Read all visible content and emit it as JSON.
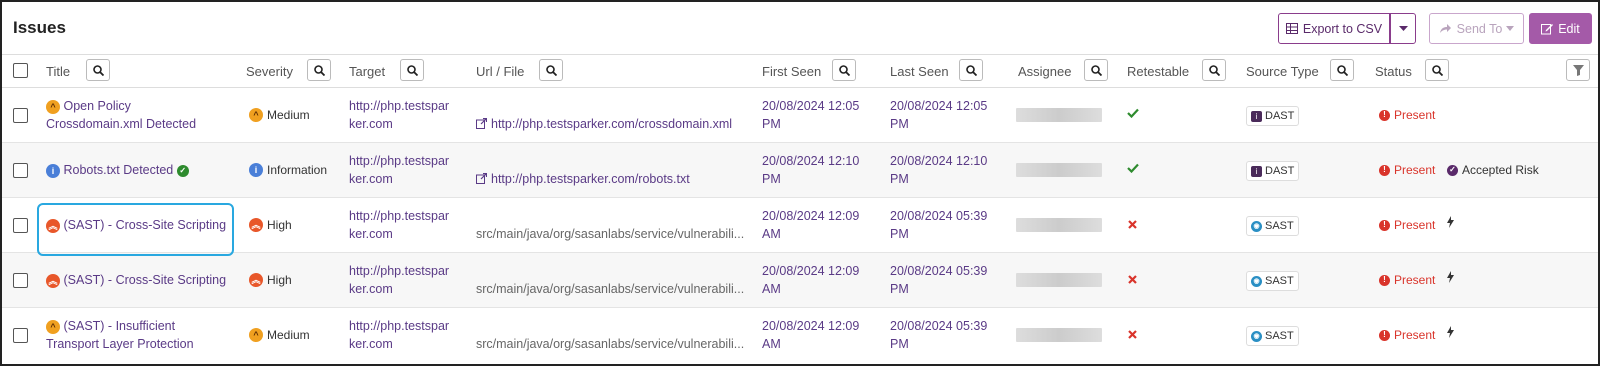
{
  "header": {
    "title": "Issues",
    "export_label": "Export to CSV",
    "send_label": "Send To",
    "edit_label": "Edit"
  },
  "columns": {
    "title": "Title",
    "severity": "Severity",
    "target": "Target",
    "url": "Url / File",
    "first_seen": "First Seen",
    "last_seen": "Last Seen",
    "assignee": "Assignee",
    "retestable": "Retestable",
    "source_type": "Source Type",
    "status": "Status"
  },
  "rows": [
    {
      "title_line1": "Open Policy",
      "title_line2": "Crossdomain.xml Detected",
      "severity": "Medium",
      "target_line1": "http://php.testspar",
      "target_line2": "ker.com",
      "url": "http://php.testsparker.com/crossdomain.xml",
      "first_line1": "20/08/2024 12:05",
      "first_line2": "PM",
      "last_line1": "20/08/2024 12:05",
      "last_line2": "PM",
      "retestable": "yes",
      "source": "DAST",
      "status": "Present",
      "extra": ""
    },
    {
      "title_line1": "Robots.txt Detected",
      "title_line2": "",
      "severity": "Information",
      "target_line1": "http://php.testspar",
      "target_line2": "ker.com",
      "url": "http://php.testsparker.com/robots.txt",
      "first_line1": "20/08/2024 12:10",
      "first_line2": "PM",
      "last_line1": "20/08/2024 12:10",
      "last_line2": "PM",
      "retestable": "yes",
      "source": "DAST",
      "status": "Present",
      "extra": "Accepted Risk"
    },
    {
      "title_line1": "(SAST) - Cross-Site Scripting",
      "title_line2": "",
      "severity": "High",
      "target_line1": "http://php.testspar",
      "target_line2": "ker.com",
      "url": "src/main/java/org/sasanlabs/service/vulnerabili...",
      "first_line1": "20/08/2024 12:09",
      "first_line2": "AM",
      "last_line1": "20/08/2024 05:39",
      "last_line2": "PM",
      "retestable": "no",
      "source": "SAST",
      "status": "Present",
      "extra": ""
    },
    {
      "title_line1": "(SAST) - Cross-Site Scripting",
      "title_line2": "",
      "severity": "High",
      "target_line1": "http://php.testspar",
      "target_line2": "ker.com",
      "url": "src/main/java/org/sasanlabs/service/vulnerabili...",
      "first_line1": "20/08/2024 12:09",
      "first_line2": "AM",
      "last_line1": "20/08/2024 05:39",
      "last_line2": "PM",
      "retestable": "no",
      "source": "SAST",
      "status": "Present",
      "extra": ""
    },
    {
      "title_line1": "(SAST) - Insufficient",
      "title_line2": "Transport Layer Protection",
      "severity": "Medium",
      "target_line1": "http://php.testspar",
      "target_line2": "ker.com",
      "url": "src/main/java/org/sasanlabs/service/vulnerabili...",
      "first_line1": "20/08/2024 12:09",
      "first_line2": "AM",
      "last_line1": "20/08/2024 05:39",
      "last_line2": "PM",
      "retestable": "no",
      "source": "SAST",
      "status": "Present",
      "extra": ""
    }
  ],
  "colors": {
    "accent": "#8a3d8c",
    "link": "#5a3a86",
    "present": "#d9342b",
    "check": "#2e8b2e",
    "cross": "#d9342b",
    "highlight": "#29a8e0",
    "medium": "#f0a020",
    "high": "#e8572a",
    "info": "#4a7fd8"
  }
}
